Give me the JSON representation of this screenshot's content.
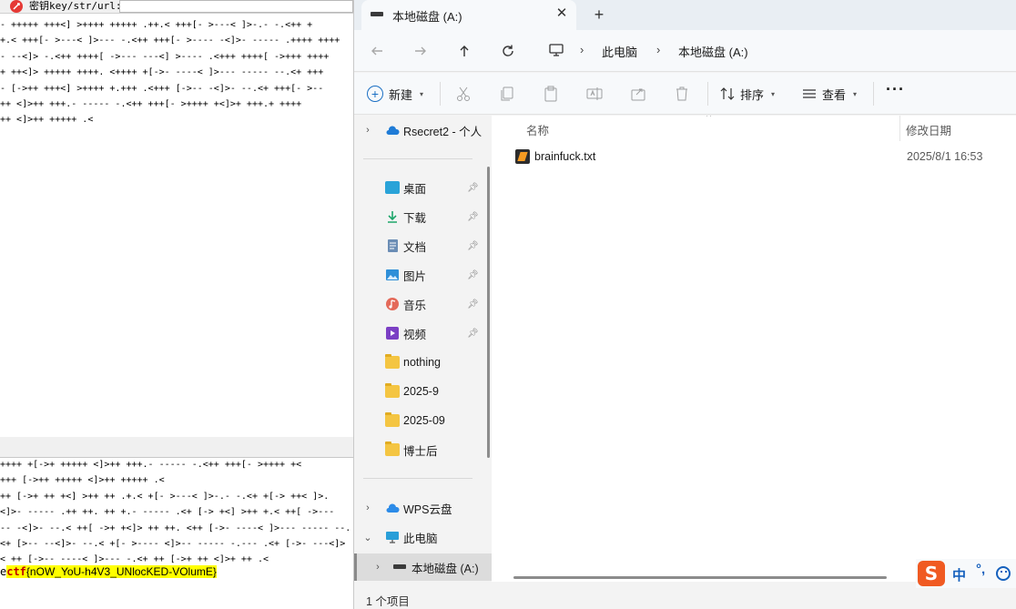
{
  "editor": {
    "key_label": "密钥key/str/url:",
    "code_top": [
      "- +++++ +++<] >++++ +++++ .++.< +++[- >---< ]>-.- -.<++ +",
      "+.< +++[- >---< ]>--- -.<++ +++[- >---- -<]>- ----- .++++ ++++",
      "- --<]> -.<++ ++++[ ->--- ---<] >---- .<+++ ++++[ ->+++ ++++",
      "+ ++<]> +++++ ++++. <++++ +[->- ----< ]>--- ----- --.<+ +++",
      "- [->++ +++<] >++++ +.+++ .<+++ [->-- -<]>- --.<+ +++[- >--",
      "++ <]>++ +++.- ----- -.<++ +++[- >++++ +<]>+ +++.+ ++++",
      "++ <]>++ +++++ .<"
    ],
    "code_bottom": [
      "++++ +[->+ +++++ <]>++ +++.- ----- -.<++ +++[- >++++ +<",
      "+++ [->++ +++++ <]>++ +++++ .<",
      "++ [->+ ++ +<] >++ ++ .+.< +[- >---< ]>-.- -.<+ +[-> ++< ]>.",
      "<]>- ----- .++ ++. ++ +.- ----- .<+ [-> +<] >++ +.< ++[ ->---",
      "-- -<]>- --.< ++[ ->+ +<]> ++ ++. <++ [->- ----< ]>--- ----- --.",
      "<+ [>-- --<]>- --.< +[- >---- <]>-- ----- -.--- .<+ [->- ---<]>",
      "< ++ [->-- ----< ]>--- -.<+ ++ [->+ ++ <]>+ ++ .<"
    ],
    "flag_lead": "e",
    "flag_prefix": "ctf",
    "flag_body": "{nOW_YoU-h4V3_UNlocKED-VOlumE}"
  },
  "explorer": {
    "tab_title": "本地磁盘 (A:)",
    "tab_close": "✕",
    "tab_new": "+",
    "breadcrumb": [
      "此电脑",
      "本地磁盘 (A:)"
    ],
    "breadcrumb_sep": "›",
    "toolbar": {
      "new_label": "新建",
      "sort_label": "排序",
      "view_label": "查看",
      "more_label": "···"
    },
    "nav": {
      "cloud_item": "Rsecret2 - 个人",
      "quick_access": [
        {
          "label": "桌面",
          "icon": "desktop-icon"
        },
        {
          "label": "下载",
          "icon": "download-icon"
        },
        {
          "label": "文档",
          "icon": "document-icon"
        },
        {
          "label": "图片",
          "icon": "picture-icon"
        },
        {
          "label": "音乐",
          "icon": "music-icon"
        },
        {
          "label": "视频",
          "icon": "video-icon"
        },
        {
          "label": "nothing",
          "icon": "folder-icon"
        },
        {
          "label": "2025-9",
          "icon": "folder-icon"
        },
        {
          "label": "2025-09",
          "icon": "folder-icon"
        },
        {
          "label": "博士后",
          "icon": "folder-icon"
        }
      ],
      "wps": "WPS云盘",
      "this_pc": "此电脑",
      "drive": "本地磁盘 (A:)"
    },
    "columns": {
      "name": "名称",
      "date": "修改日期"
    },
    "files": [
      {
        "name": "brainfuck.txt",
        "date": "2025/8/1 16:53",
        "icon": "sublime-text-icon"
      }
    ],
    "status": "1 个项目"
  },
  "ime": {
    "logo": "S",
    "mode": "中",
    "punct": "°,"
  },
  "colors": {
    "highlight": "#ffff00",
    "flag_prefix": "#c00000",
    "accent": "#1a6fc4",
    "ime_orange": "#f05a22"
  }
}
